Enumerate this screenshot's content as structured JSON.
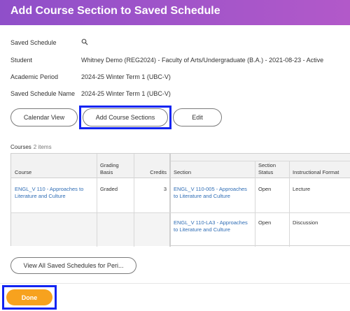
{
  "header": {
    "title": "Add Course Section to Saved Schedule"
  },
  "fields": {
    "saved_schedule_label": "Saved Schedule",
    "student_label": "Student",
    "student_value": "Whitney Demo (REG2024) - Faculty of Arts/Undergraduate (B.A.) - 2021-08-23 - Active",
    "academic_period_label": "Academic Period",
    "academic_period_value": "2024-25 Winter Term 1 (UBC-V)",
    "saved_schedule_name_label": "Saved Schedule Name",
    "saved_schedule_name_value": "2024-25 Winter Term 1 (UBC-V)"
  },
  "actions": {
    "calendar_view": "Calendar View",
    "add_course_sections": "Add Course Sections",
    "edit": "Edit"
  },
  "courses": {
    "heading": "Courses",
    "count": "2 items",
    "columns": {
      "course": "Course",
      "grading_basis_1": "Grading",
      "grading_basis_2": "Basis",
      "credits": "Credits",
      "section": "Section",
      "section_status_1": "Section",
      "section_status_2": "Status",
      "instructional_format": "Instructional Format"
    },
    "rows": [
      {
        "course_1": "ENGL_V 110 - Approaches to",
        "course_2": "Literature and Culture",
        "grading_basis": "Graded",
        "credits": "3",
        "section_1": "ENGL_V 110-005 - Approaches",
        "section_2": "to Literature and Culture",
        "section_status": "Open",
        "instructional_format": "Lecture"
      },
      {
        "section_1": "ENGL_V 110-LA3 - Approaches",
        "section_2": "to Literature and Culture",
        "section_status": "Open",
        "instructional_format": "Discussion"
      }
    ]
  },
  "footer": {
    "view_all": "View All Saved Schedules for Peri...",
    "done": "Done"
  },
  "colors": {
    "header_gradient_start": "#8f4fc9",
    "header_gradient_end": "#b259c9",
    "highlight": "#1224f2",
    "done_button": "#f7a21e",
    "link": "#2f6db5"
  }
}
